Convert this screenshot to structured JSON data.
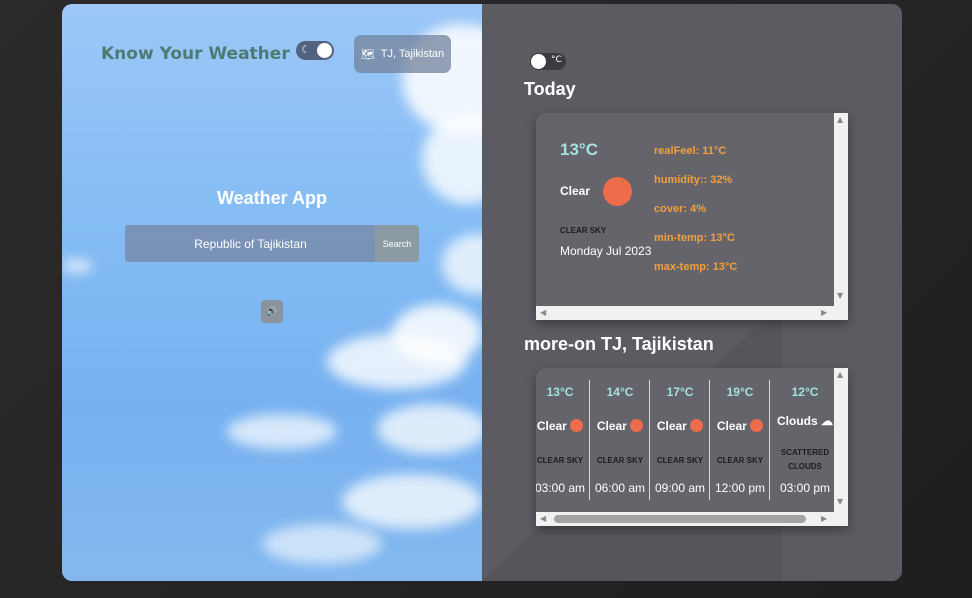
{
  "header": {
    "brand": "Know Your Weather",
    "location_button": "TJ, Tajikistan"
  },
  "search": {
    "title": "Weather App",
    "value": "Republic of Tajikistan",
    "button": "Search"
  },
  "unit_toggle_label": "°C",
  "today": {
    "heading": "Today",
    "temp": "13°C",
    "condition": "Clear",
    "sky": "CLEAR SKY",
    "date": "Monday Jul 2023",
    "stats": [
      "realFeel: 11°C",
      "humidity:: 32%",
      "cover: 4%",
      "min-temp: 13°C",
      "max-temp: 13°C"
    ]
  },
  "forecast": {
    "heading": "more-on TJ, Tajikistan",
    "items": [
      {
        "temp": "13°C",
        "condition": "Clear",
        "icon": "sun-icon",
        "sky": "CLEAR SKY",
        "time": "03:00 am"
      },
      {
        "temp": "14°C",
        "condition": "Clear",
        "icon": "sun-icon",
        "sky": "CLEAR SKY",
        "time": "06:00 am"
      },
      {
        "temp": "17°C",
        "condition": "Clear",
        "icon": "sun-icon",
        "sky": "CLEAR SKY",
        "time": "09:00 am"
      },
      {
        "temp": "19°C",
        "condition": "Clear",
        "icon": "sun-icon",
        "sky": "CLEAR SKY",
        "time": "12:00 pm"
      },
      {
        "temp": "12°C",
        "condition": "Clouds",
        "icon": "cloud-icon",
        "sky": "SCATTERED CLOUDS",
        "time": "03:00 pm"
      }
    ]
  },
  "colors": {
    "accent_temp": "#9fe3de",
    "stat_orange": "#f2a03c",
    "sun": "#ec6c4c",
    "panel": "#5d5b62"
  }
}
